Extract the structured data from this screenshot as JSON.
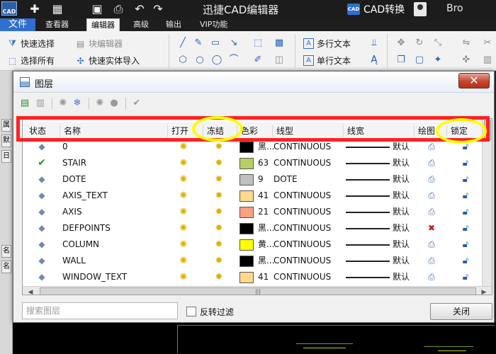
{
  "app": {
    "logo_text": "CAD",
    "title": "迅捷CAD编辑器",
    "convert_label": "CAD转换",
    "convert_badge": "CAD",
    "user_name": "Bro"
  },
  "menu": {
    "file": "文件",
    "items": [
      "查看器",
      "编辑器",
      "高级",
      "输出",
      "VIP功能"
    ],
    "active": "编辑器"
  },
  "ribbon": {
    "quick_select": "快速选择",
    "block_editor": "块编辑器",
    "select_all": "选择所有",
    "quick_entity_import": "快速实体导入",
    "mtext": "多行文本",
    "stext": "单行文本"
  },
  "left_strip": [
    "属",
    "默",
    "日",
    "名",
    "名"
  ],
  "dialog": {
    "title": "图层",
    "close_glyph": "✕",
    "columns": [
      "状态",
      "名称",
      "打开",
      "冻结",
      "色彩",
      "线型",
      "线宽",
      "绘图",
      "锁定"
    ],
    "search_placeholder": "搜索图层",
    "invert_filter": "反转过滤",
    "close_button": "关闭"
  },
  "layers": [
    {
      "name": "0",
      "current": false,
      "color_label": "黑...",
      "color_hex": "#000000",
      "linetype": "CONTINUOUS",
      "lineweight": "默认",
      "plot": true
    },
    {
      "name": "STAIR",
      "current": true,
      "color_label": "63",
      "color_hex": "#b5d164",
      "linetype": "CONTINUOUS",
      "lineweight": "默认",
      "plot": true
    },
    {
      "name": "DOTE",
      "current": false,
      "color_label": "9",
      "color_hex": "#c0c0c0",
      "linetype": "DOTE",
      "lineweight": "默认",
      "plot": true
    },
    {
      "name": "AXIS_TEXT",
      "current": false,
      "color_label": "41",
      "color_hex": "#ffd98a",
      "linetype": "CONTINUOUS",
      "lineweight": "默认",
      "plot": true
    },
    {
      "name": "AXIS",
      "current": false,
      "color_label": "21",
      "color_hex": "#ff9f80",
      "linetype": "CONTINUOUS",
      "lineweight": "默认",
      "plot": true
    },
    {
      "name": "DEFPOINTS",
      "current": false,
      "color_label": "黑...",
      "color_hex": "#000000",
      "linetype": "CONTINUOUS",
      "lineweight": "默认",
      "plot": false
    },
    {
      "name": "COLUMN",
      "current": false,
      "color_label": "黄...",
      "color_hex": "#ffff00",
      "linetype": "CONTINUOUS",
      "lineweight": "默认",
      "plot": true
    },
    {
      "name": "WALL",
      "current": false,
      "color_label": "黑...",
      "color_hex": "#000000",
      "linetype": "CONTINUOUS",
      "lineweight": "默认",
      "plot": true
    },
    {
      "name": "WINDOW_TEXT",
      "current": false,
      "color_label": "41",
      "color_hex": "#ffd98a",
      "linetype": "CONTINUOUS",
      "lineweight": "默认",
      "plot": true
    }
  ],
  "colors": {
    "highlight_frame": "#ff2222",
    "highlight_ring": "#ffff00",
    "accent": "#2f6fcf"
  }
}
